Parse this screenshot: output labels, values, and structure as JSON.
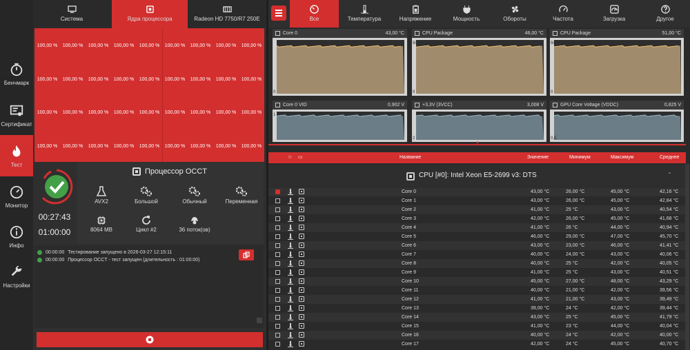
{
  "nav": {
    "items": [
      {
        "label": "Бенчмарк",
        "icon": "stopwatch-icon"
      },
      {
        "label": "Сертификат",
        "icon": "certificate-icon"
      },
      {
        "label": "Тест",
        "icon": "flame-icon",
        "active": true
      },
      {
        "label": "Монитор",
        "icon": "gauge-icon"
      },
      {
        "label": "Инфо",
        "icon": "info-icon"
      },
      {
        "label": "Настройки",
        "icon": "wrench-icon"
      }
    ]
  },
  "test_tabs": [
    {
      "label": "Система",
      "icon": "monitor-icon"
    },
    {
      "label": "Ядра процессора",
      "icon": "cpu-icon",
      "active": true
    },
    {
      "label": "Radeon HD 7750/R7 250E",
      "icon": "gpu-icon"
    }
  ],
  "core_grid": {
    "value": "100,00 %",
    "rows": 4,
    "cols": 9
  },
  "status": {
    "elapsed": "00:27:43",
    "duration": "01:00:00",
    "state": "ok"
  },
  "processor_panel": {
    "title": "Процессор OCCT",
    "options": [
      {
        "label": "AVX2",
        "icon": "flask-icon"
      },
      {
        "label": "Большой",
        "icon": "gears-icon"
      },
      {
        "label": "Обычный",
        "icon": "gears-icon"
      },
      {
        "label": "Переменная",
        "icon": "gears-icon"
      },
      {
        "label": "8064 MB",
        "icon": "chip-icon"
      },
      {
        "label": "Цикл #2",
        "icon": "refresh-icon"
      },
      {
        "label": "36 поток(ов)",
        "icon": "worker-icon"
      }
    ]
  },
  "log": [
    {
      "time": "00:00:00",
      "text": "Тестирование запущено в 2026-03-27 12:15:11"
    },
    {
      "time": "00:00:00",
      "text": "Процессор OCCT - тест запущен (длительность : 01:00:00)"
    }
  ],
  "categories": [
    {
      "label": "Все",
      "icon": "dashboard-icon",
      "active": true
    },
    {
      "label": "Температура",
      "icon": "thermometer-icon"
    },
    {
      "label": "Напряжение",
      "icon": "battery-icon"
    },
    {
      "label": "Мощность",
      "icon": "plug-icon"
    },
    {
      "label": "Обороты",
      "icon": "fan-icon"
    },
    {
      "label": "Частота",
      "icon": "speedometer-icon"
    },
    {
      "label": "Загрузка",
      "icon": "load-icon"
    },
    {
      "label": "Другое",
      "icon": "question-icon"
    }
  ],
  "charts": [
    {
      "name": "Core 0",
      "value": "43,00 °C",
      "ymax": "",
      "ymin": "0",
      "fill": "#a08b6c"
    },
    {
      "name": "CPU Package",
      "value": "46,00 °C",
      "ymax": "50",
      "ymin": "0",
      "fill": "#a08b6c"
    },
    {
      "name": "CPU Package",
      "value": "51,00 °C",
      "ymax": "50",
      "ymin": "0",
      "fill": "#a08b6c"
    },
    {
      "name": "Core 0 VID",
      "value": "0,902 V",
      "ymax": "1",
      "ymin": "",
      "fill": "#6b7d86"
    },
    {
      "name": "+3,3V (3VCC)",
      "value": "3,008 V",
      "ymax": "",
      "ymin": "2",
      "fill": "#6b7d86"
    },
    {
      "name": "GPU Core Voltage (VDDC)",
      "value": "0,825 V",
      "ymax": "",
      "ymin": "0,5",
      "fill": "#6b7d86"
    }
  ],
  "table": {
    "headers": {
      "name": "Название",
      "value": "Значение",
      "min": "Минимум",
      "max": "Максимум",
      "avg": "Среднее"
    },
    "group": "CPU [#0]: Intel Xeon E5-2699 v3: DTS",
    "rows": [
      {
        "name": "Core 0",
        "value": "43,00 °C",
        "min": "26,00 °C",
        "max": "45,00 °C",
        "avg": "42,16 °C",
        "checked": true
      },
      {
        "name": "Core 1",
        "value": "43,00 °C",
        "min": "26,00 °C",
        "max": "45,00 °C",
        "avg": "42,84 °C"
      },
      {
        "name": "Core 2",
        "value": "41,00 °C",
        "min": "25 °C",
        "max": "43,00 °C",
        "avg": "40,54 °C"
      },
      {
        "name": "Core 3",
        "value": "42,00 °C",
        "min": "26,00 °C",
        "max": "45,00 °C",
        "avg": "41,68 °C"
      },
      {
        "name": "Core 4",
        "value": "41,00 °C",
        "min": "26 °C",
        "max": "44,00 °C",
        "avg": "40,94 °C"
      },
      {
        "name": "Core 5",
        "value": "46,00 °C",
        "min": "29,00 °C",
        "max": "47,00 °C",
        "avg": "45,70 °C"
      },
      {
        "name": "Core 6",
        "value": "43,00 °C",
        "min": "23,00 °C",
        "max": "46,00 °C",
        "avg": "41,41 °C"
      },
      {
        "name": "Core 7",
        "value": "40,00 °C",
        "min": "24,00 °C",
        "max": "43,00 °C",
        "avg": "40,06 °C"
      },
      {
        "name": "Core 8",
        "value": "40,00 °C",
        "min": "25 °C",
        "max": "42,00 °C",
        "avg": "40,05 °C"
      },
      {
        "name": "Core 9",
        "value": "41,00 °C",
        "min": "25 °C",
        "max": "43,00 °C",
        "avg": "40,51 °C"
      },
      {
        "name": "Core 10",
        "value": "45,00 °C",
        "min": "27,00 °C",
        "max": "48,00 °C",
        "avg": "43,29 °C"
      },
      {
        "name": "Core 11",
        "value": "40,00 °C",
        "min": "21,00 °C",
        "max": "42,00 °C",
        "avg": "39,56 °C"
      },
      {
        "name": "Core 12",
        "value": "41,00 °C",
        "min": "21,00 °C",
        "max": "43,00 °C",
        "avg": "39,49 °C"
      },
      {
        "name": "Core 13",
        "value": "39,00 °C",
        "min": "24 °C",
        "max": "42,00 °C",
        "avg": "39,44 °C"
      },
      {
        "name": "Core 14",
        "value": "43,00 °C",
        "min": "25 °C",
        "max": "45,00 °C",
        "avg": "41,79 °C"
      },
      {
        "name": "Core 15",
        "value": "41,00 °C",
        "min": "23 °C",
        "max": "44,00 °C",
        "avg": "40,04 °C"
      },
      {
        "name": "Core 16",
        "value": "40,00 °C",
        "min": "24 °C",
        "max": "42,00 °C",
        "avg": "40,00 °C"
      },
      {
        "name": "Core 17",
        "value": "42,00 °C",
        "min": "24 °C",
        "max": "45,00 °C",
        "avg": "40,70 °C"
      }
    ]
  },
  "colors": {
    "accent": "#d32f2f",
    "ok": "#43a047",
    "temp_fill": "#a08b6c",
    "volt_fill": "#6b7d86"
  }
}
